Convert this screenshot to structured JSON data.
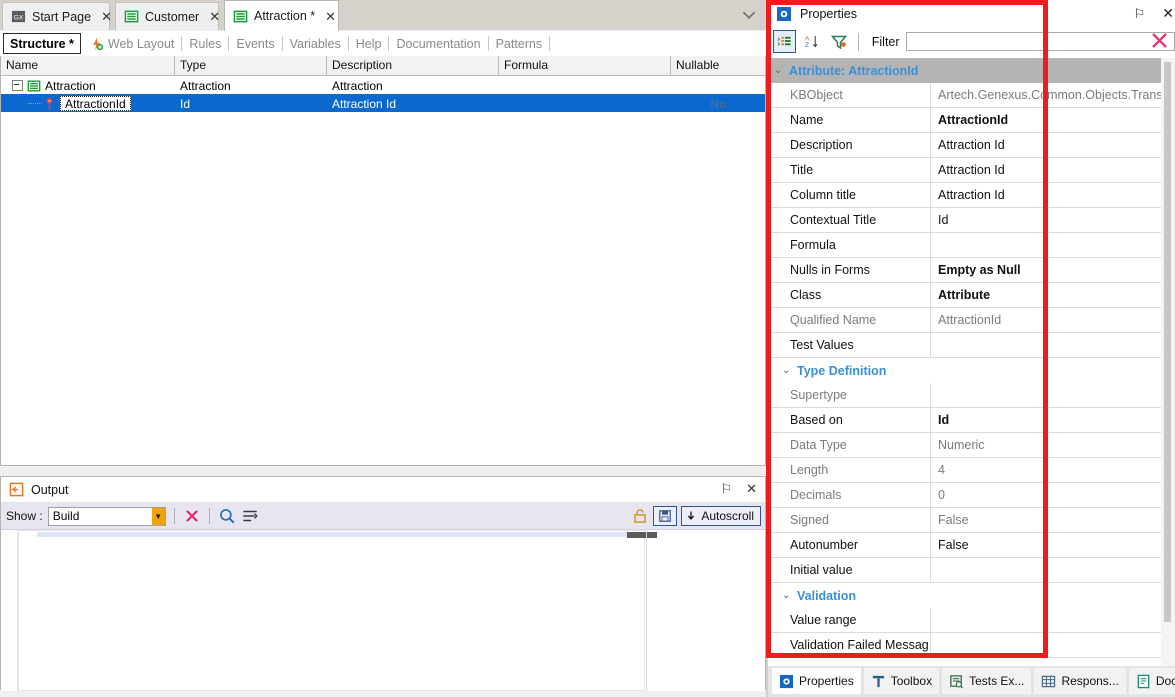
{
  "window": {
    "doc_tabs": [
      {
        "label": "Start Page",
        "icon": "genexus-logo-icon",
        "close": "✕",
        "active": false
      },
      {
        "label": "Customer",
        "icon": "transaction-icon",
        "close": "✕",
        "active": false
      },
      {
        "label": "Attraction *",
        "icon": "transaction-icon",
        "close": "✕",
        "active": true
      }
    ],
    "tabbar_overflow_icon": "chevron-down-icon"
  },
  "sub_tabs": [
    {
      "label": "Structure *",
      "active": true,
      "icon": ""
    },
    {
      "label": "Web Layout",
      "active": false,
      "icon": "web-layout-icon"
    },
    {
      "label": "Rules",
      "active": false,
      "icon": ""
    },
    {
      "label": "Events",
      "active": false,
      "icon": ""
    },
    {
      "label": "Variables",
      "active": false,
      "icon": ""
    },
    {
      "label": "Help",
      "active": false,
      "icon": ""
    },
    {
      "label": "Documentation",
      "active": false,
      "icon": ""
    },
    {
      "label": "Patterns",
      "active": false,
      "icon": ""
    }
  ],
  "structure_grid": {
    "columns": [
      "Name",
      "Type",
      "Description",
      "Formula",
      "Nullable"
    ],
    "rows": [
      {
        "name": "Attraction",
        "type": "Attraction",
        "description": "Attraction",
        "formula": "",
        "nullable": "",
        "level": 0,
        "icon": "transaction-icon",
        "selected": false,
        "editing": false
      },
      {
        "name": "AttractionId",
        "type": "Id",
        "description": "Attraction Id",
        "formula": "",
        "nullable": "No",
        "level": 1,
        "icon": "primary-key-icon",
        "selected": true,
        "editing": true
      }
    ]
  },
  "output": {
    "title": "Output",
    "title_icon": "output-icon",
    "pin_icon": "⚐",
    "close_icon": "✕",
    "show_label": "Show :",
    "show_value": "Build",
    "toolbar_icons": [
      "clear-output-icon",
      "find-icon",
      "word-wrap-icon",
      "lock-icon",
      "save-output-icon"
    ],
    "autoscroll_label": "Autoscroll",
    "autoscroll_icon": "arrow-down-icon",
    "body_text": ""
  },
  "properties": {
    "title": "Properties",
    "title_icon": "properties-gear-icon",
    "pin_icon": "⚐",
    "close_icon": "✕",
    "toolbar": {
      "categorized_icon": "categorized-view-icon",
      "alphabetical_icon": "alphabetical-sort-icon",
      "filter_toggle_icon": "filter-funnel-icon",
      "filter_label": "Filter",
      "filter_value": "",
      "filter_placeholder": "",
      "clear_icon": "clear-filter-icon"
    },
    "sections": [
      {
        "kind": "section",
        "title": "Attribute: AttractionId",
        "caret": "⌄",
        "level": 0
      },
      {
        "kind": "row",
        "key": "KBObject",
        "value": "Artech.Genexus.Common.Objects.Trans...",
        "key_style": "ro",
        "value_style": "ro"
      },
      {
        "kind": "row",
        "key": "Name",
        "value": "AttractionId",
        "key_style": "rw",
        "value_style": "bold"
      },
      {
        "kind": "row",
        "key": "Description",
        "value": "Attraction Id",
        "key_style": "rw",
        "value_style": "rw"
      },
      {
        "kind": "row",
        "key": "Title",
        "value": "Attraction Id",
        "key_style": "rw",
        "value_style": "rw"
      },
      {
        "kind": "row",
        "key": "Column title",
        "value": "Attraction Id",
        "key_style": "rw",
        "value_style": "rw"
      },
      {
        "kind": "row",
        "key": "Contextual Title",
        "value": "Id",
        "key_style": "rw",
        "value_style": "rw"
      },
      {
        "kind": "row",
        "key": "Formula",
        "value": "",
        "key_style": "rw",
        "value_style": "rw"
      },
      {
        "kind": "row",
        "key": "Nulls in Forms",
        "value": "Empty as Null",
        "key_style": "rw",
        "value_style": "bold"
      },
      {
        "kind": "row",
        "key": "Class",
        "value": "Attribute",
        "key_style": "rw",
        "value_style": "bold"
      },
      {
        "kind": "row",
        "key": "Qualified Name",
        "value": "AttractionId",
        "key_style": "ro",
        "value_style": "ro"
      },
      {
        "kind": "row",
        "key": "Test Values",
        "value": "",
        "key_style": "rw",
        "value_style": "rw"
      },
      {
        "kind": "subsection",
        "title": "Type Definition",
        "caret": "⌄"
      },
      {
        "kind": "row",
        "key": "Supertype",
        "value": "",
        "key_style": "ro",
        "value_style": "ro"
      },
      {
        "kind": "row",
        "key": "Based on",
        "value": "Id",
        "key_style": "rw",
        "value_style": "bold"
      },
      {
        "kind": "row",
        "key": "Data Type",
        "value": "Numeric",
        "key_style": "ro",
        "value_style": "ro"
      },
      {
        "kind": "row",
        "key": "Length",
        "value": "4",
        "key_style": "ro",
        "value_style": "ro"
      },
      {
        "kind": "row",
        "key": "Decimals",
        "value": "0",
        "key_style": "ro",
        "value_style": "ro"
      },
      {
        "kind": "row",
        "key": "Signed",
        "value": "False",
        "key_style": "ro",
        "value_style": "ro"
      },
      {
        "kind": "row",
        "key": "Autonumber",
        "value": "False",
        "key_style": "rw",
        "value_style": "rw"
      },
      {
        "kind": "row",
        "key": "Initial value",
        "value": "",
        "key_style": "rw",
        "value_style": "rw"
      },
      {
        "kind": "subsection",
        "title": "Validation",
        "caret": "⌄"
      },
      {
        "kind": "row",
        "key": "Value range",
        "value": "",
        "key_style": "rw",
        "value_style": "rw"
      },
      {
        "kind": "row",
        "key": "Validation Failed Messag",
        "value": "",
        "key_style": "rw",
        "value_style": "rw"
      }
    ]
  },
  "dock_tabs": [
    {
      "label": "Properties",
      "icon": "properties-gear-icon",
      "active": true
    },
    {
      "label": "Toolbox",
      "icon": "toolbox-icon",
      "active": false
    },
    {
      "label": "Tests Ex...",
      "icon": "tests-explorer-icon",
      "active": false
    },
    {
      "label": "Respons...",
      "icon": "responsive-grid-icon",
      "active": false
    },
    {
      "label": "Docume...",
      "icon": "document-icon",
      "active": false
    }
  ],
  "annotation": {
    "color": "#ee1c1c",
    "shape": "rectangle"
  }
}
